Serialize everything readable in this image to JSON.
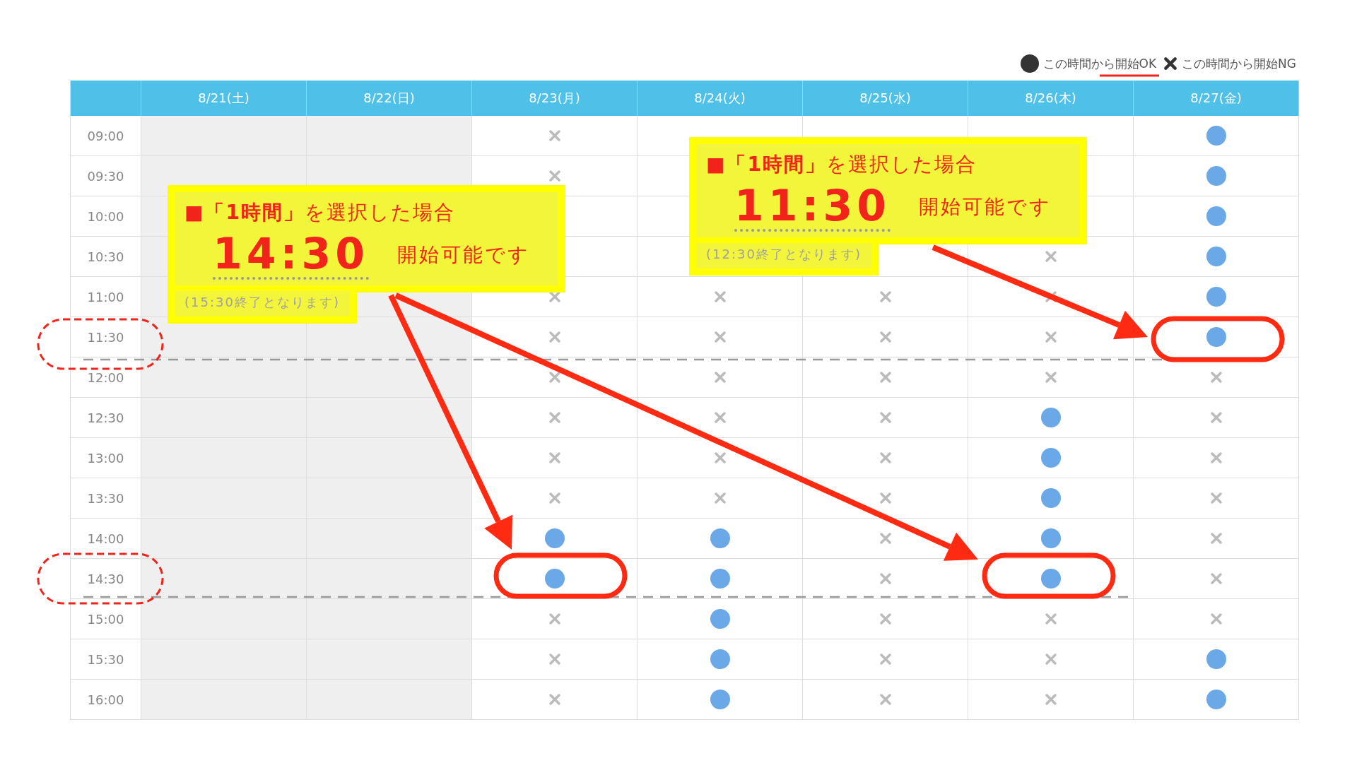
{
  "legend": [
    {
      "kind": "ok",
      "label": "この時間から開始OK"
    },
    {
      "kind": "ng",
      "label": "この時間から開始NG"
    }
  ],
  "table": {
    "columns": [
      {
        "label": "8/21(土)",
        "closed": true
      },
      {
        "label": "8/22(日)",
        "closed": true
      },
      {
        "label": "8/23(月)",
        "closed": false
      },
      {
        "label": "8/24(火)",
        "closed": false
      },
      {
        "label": "8/25(水)",
        "closed": false
      },
      {
        "label": "8/26(木)",
        "closed": false
      },
      {
        "label": "8/27(金)",
        "closed": false
      }
    ],
    "rows": [
      {
        "time": "09:00",
        "cells": [
          {
            "kind": "empty"
          },
          {
            "kind": "empty"
          },
          {
            "kind": "ng"
          },
          {
            "kind": "hidden"
          },
          {
            "kind": "hidden"
          },
          {
            "kind": "hidden"
          },
          {
            "kind": "ok"
          }
        ]
      },
      {
        "time": "09:30",
        "cells": [
          {
            "kind": "empty"
          },
          {
            "kind": "empty"
          },
          {
            "kind": "ng"
          },
          {
            "kind": "hidden"
          },
          {
            "kind": "covered"
          },
          {
            "kind": "hidden"
          },
          {
            "kind": "ok"
          }
        ]
      },
      {
        "time": "10:00",
        "cells": [
          {
            "kind": "empty"
          },
          {
            "kind": "covered"
          },
          {
            "kind": "hidden"
          },
          {
            "kind": "hidden"
          },
          {
            "kind": "covered"
          },
          {
            "kind": "hidden"
          },
          {
            "kind": "ok"
          }
        ]
      },
      {
        "time": "10:30",
        "cells": [
          {
            "kind": "empty"
          },
          {
            "kind": "covered"
          },
          {
            "kind": "hidden"
          },
          {
            "kind": "hidden"
          },
          {
            "kind": "hidden"
          },
          {
            "kind": "ng"
          },
          {
            "kind": "ok"
          }
        ]
      },
      {
        "time": "11:00",
        "cells": [
          {
            "kind": "empty"
          },
          {
            "kind": "empty"
          },
          {
            "kind": "ng"
          },
          {
            "kind": "ng"
          },
          {
            "kind": "ng"
          },
          {
            "kind": "ng"
          },
          {
            "kind": "ok"
          }
        ]
      },
      {
        "time": "11:30",
        "cells": [
          {
            "kind": "empty"
          },
          {
            "kind": "empty"
          },
          {
            "kind": "ng"
          },
          {
            "kind": "ng"
          },
          {
            "kind": "ng"
          },
          {
            "kind": "ng"
          },
          {
            "kind": "ok"
          }
        ]
      },
      {
        "time": "12:00",
        "cells": [
          {
            "kind": "empty"
          },
          {
            "kind": "empty"
          },
          {
            "kind": "ng"
          },
          {
            "kind": "ng"
          },
          {
            "kind": "ng"
          },
          {
            "kind": "ng"
          },
          {
            "kind": "ng"
          }
        ]
      },
      {
        "time": "12:30",
        "cells": [
          {
            "kind": "empty"
          },
          {
            "kind": "empty"
          },
          {
            "kind": "ng"
          },
          {
            "kind": "ng"
          },
          {
            "kind": "ng"
          },
          {
            "kind": "ok"
          },
          {
            "kind": "ng"
          }
        ]
      },
      {
        "time": "13:00",
        "cells": [
          {
            "kind": "empty"
          },
          {
            "kind": "empty"
          },
          {
            "kind": "ng"
          },
          {
            "kind": "ng"
          },
          {
            "kind": "ng"
          },
          {
            "kind": "ok"
          },
          {
            "kind": "ng"
          }
        ]
      },
      {
        "time": "13:30",
        "cells": [
          {
            "kind": "empty"
          },
          {
            "kind": "empty"
          },
          {
            "kind": "ng"
          },
          {
            "kind": "ng"
          },
          {
            "kind": "ng"
          },
          {
            "kind": "ok"
          },
          {
            "kind": "ng"
          }
        ]
      },
      {
        "time": "14:00",
        "cells": [
          {
            "kind": "empty"
          },
          {
            "kind": "empty"
          },
          {
            "kind": "ok"
          },
          {
            "kind": "ok"
          },
          {
            "kind": "ng"
          },
          {
            "kind": "ok"
          },
          {
            "kind": "ng"
          }
        ]
      },
      {
        "time": "14:30",
        "cells": [
          {
            "kind": "empty"
          },
          {
            "kind": "empty"
          },
          {
            "kind": "ok"
          },
          {
            "kind": "ok"
          },
          {
            "kind": "ng"
          },
          {
            "kind": "ok"
          },
          {
            "kind": "ng"
          }
        ]
      },
      {
        "time": "15:00",
        "cells": [
          {
            "kind": "empty"
          },
          {
            "kind": "empty"
          },
          {
            "kind": "ng"
          },
          {
            "kind": "ok"
          },
          {
            "kind": "ng"
          },
          {
            "kind": "ng"
          },
          {
            "kind": "ng"
          }
        ]
      },
      {
        "time": "15:30",
        "cells": [
          {
            "kind": "empty"
          },
          {
            "kind": "empty"
          },
          {
            "kind": "ng"
          },
          {
            "kind": "ok"
          },
          {
            "kind": "ng"
          },
          {
            "kind": "ng"
          },
          {
            "kind": "ok"
          }
        ]
      },
      {
        "time": "16:00",
        "cells": [
          {
            "kind": "empty"
          },
          {
            "kind": "empty"
          },
          {
            "kind": "ng"
          },
          {
            "kind": "ok"
          },
          {
            "kind": "ng"
          },
          {
            "kind": "ng"
          },
          {
            "kind": "ok"
          }
        ]
      }
    ]
  },
  "callouts": [
    {
      "heading": "■**「1時間」**を選択した場合",
      "time": "14:30",
      "message": "開始可能です",
      "end_note": "(15:30終了となります)"
    },
    {
      "heading": "■**「1時間」**を選択した場合",
      "time": "11:30",
      "message": "開始可能です",
      "end_note": "(12:30終了となります)"
    }
  ]
}
